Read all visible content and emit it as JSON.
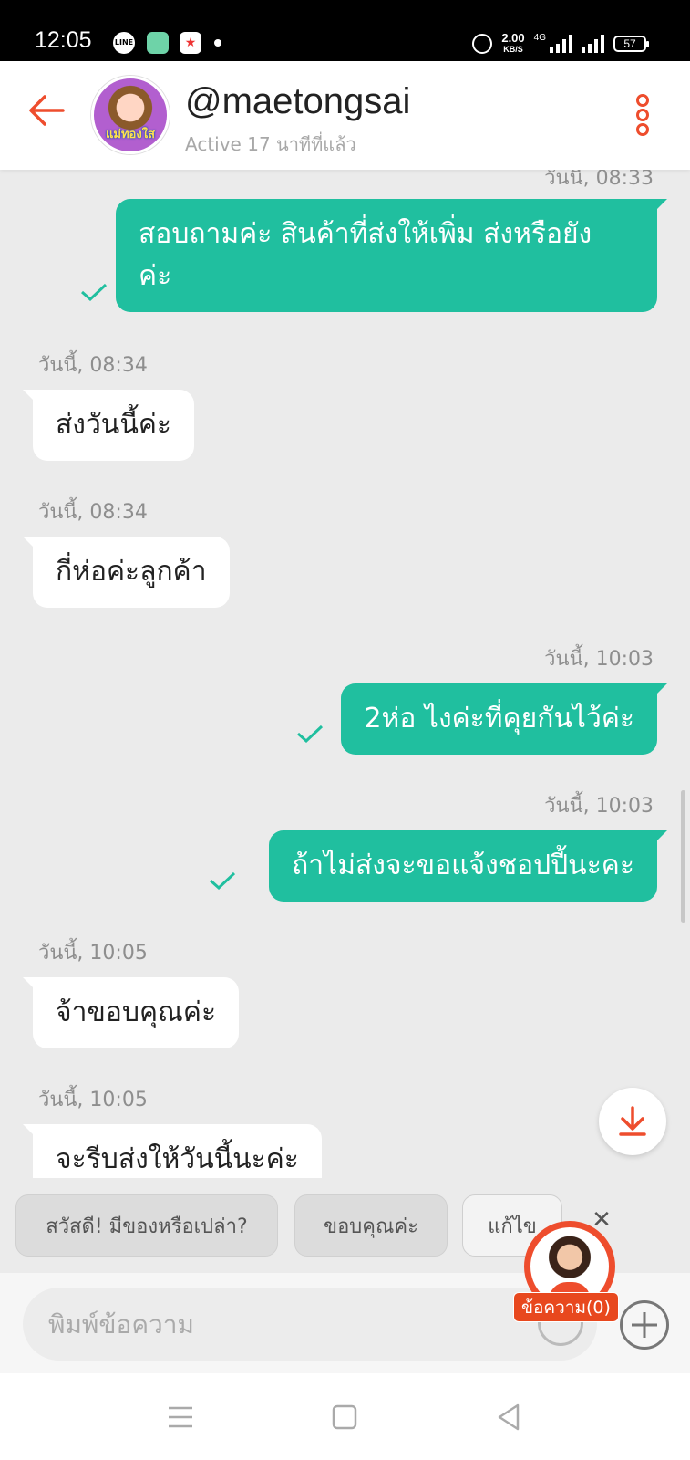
{
  "status_bar": {
    "time": "12:05",
    "line_label": "LINE",
    "speed_value": "2.00",
    "speed_unit": "KB/S",
    "network": "4G",
    "battery": "57"
  },
  "header": {
    "shop_name": "@maetongsai",
    "active_status": "Active 17 นาทีที่แล้ว",
    "avatar_text": "แม่ทองใส"
  },
  "messages": [
    {
      "direction": "outgoing",
      "timestamp": "วันนี้, 08:33",
      "text_lines": [
        "สอบถามค่ะ สินค้าที่ส่งให้เพิ่ม ส่งหรือยัง",
        "ค่ะ"
      ],
      "read": true
    },
    {
      "direction": "incoming",
      "timestamp": "วันนี้, 08:34",
      "text_lines": [
        "ส่งวันนี้ค่ะ"
      ]
    },
    {
      "direction": "incoming",
      "timestamp": "วันนี้, 08:34",
      "text_lines": [
        "กี่ห่อค่ะลูกค้า"
      ]
    },
    {
      "direction": "outgoing",
      "timestamp": "วันนี้, 10:03",
      "text_lines": [
        "2ห่อ ไงค่ะที่คุยกันไว้ค่ะ"
      ],
      "read": true
    },
    {
      "direction": "outgoing",
      "timestamp": "วันนี้, 10:03",
      "text_lines": [
        "ถ้าไม่ส่งจะขอแจ้งชอปปี้นะคะ"
      ],
      "read": true
    },
    {
      "direction": "incoming",
      "timestamp": "วันนี้, 10:05",
      "text_lines": [
        "จ้าขอบคุณค่ะ"
      ]
    },
    {
      "direction": "incoming",
      "timestamp": "วันนี้, 10:05",
      "text_lines": [
        "จะรีบส่งให้วันนี้นะค่ะ"
      ]
    }
  ],
  "quick_replies": [
    "สวัสดี! มีของหรือเปล่า?",
    "ขอบคุณค่ะ",
    "แก้ไข"
  ],
  "input": {
    "placeholder": "พิมพ์ข้อความ"
  },
  "agent": {
    "badge": "ข้อความ(0)",
    "close": "✕"
  },
  "icons": {
    "back": "arrow-left-icon",
    "menu": "kebab-menu-icon",
    "jump": "scroll-to-bottom-icon",
    "emoji": "emoji-icon",
    "plus": "plus-icon",
    "nav": [
      "menu-icon",
      "home-icon",
      "back-icon"
    ]
  },
  "colors": {
    "brand": "#ee4d2d",
    "outgoing_bubble": "#20bf9f",
    "incoming_bubble": "#ffffff",
    "background": "#ebebeb"
  }
}
